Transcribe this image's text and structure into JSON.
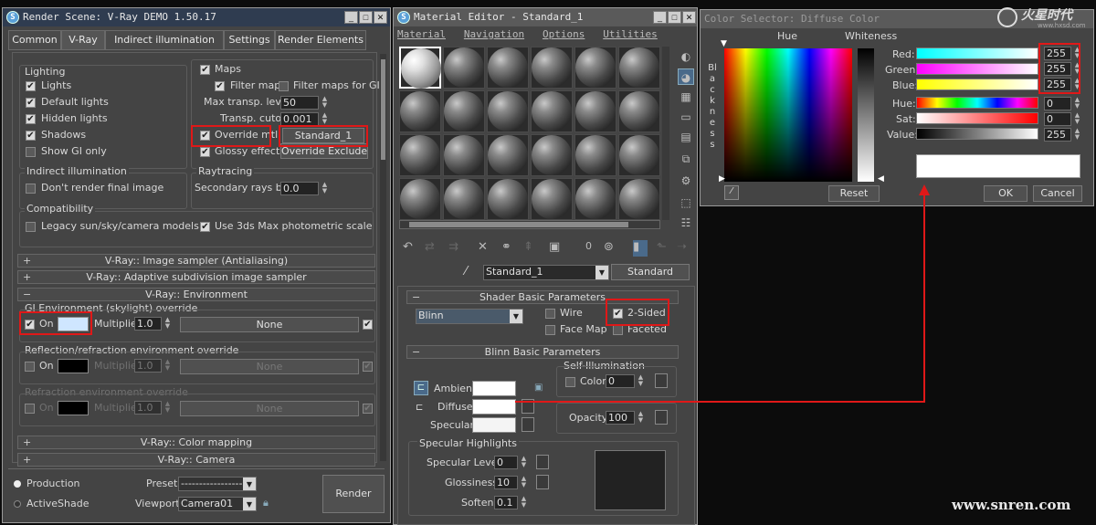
{
  "render": {
    "title": "Render Scene: V-Ray DEMO 1.50.17",
    "tabs": [
      "Common",
      "V-Ray",
      "Indirect illumination",
      "Settings",
      "Render Elements"
    ],
    "lighting": {
      "title": "Lighting",
      "lights": "Lights",
      "default_lights": "Default lights",
      "hidden_lights": "Hidden lights",
      "shadows": "Shadows",
      "show_gi_only": "Show GI only"
    },
    "materials": {
      "maps": "Maps",
      "filter_maps": "Filter maps",
      "filter_maps_gi": "Filter maps for GI",
      "max_transp_levels": "Max transp. levels",
      "max_transp_value": "50",
      "transp_cutoff": "Transp. cutoff",
      "transp_cutoff_value": "0.001",
      "override_mtl": "Override mtl:",
      "override_mtl_value": "Standard_1",
      "glossy_effects": "Glossy effects",
      "override_exclude": "Override Exclude..."
    },
    "indirect": {
      "title": "Indirect illumination",
      "dont_render": "Don't render final image"
    },
    "raytracing": {
      "title": "Raytracing",
      "secondary_bias": "Secondary rays bias",
      "secondary_bias_value": "0.0"
    },
    "compat": {
      "title": "Compatibility",
      "legacy": "Legacy sun/sky/camera models",
      "photometric": "Use 3ds Max photometric scale"
    },
    "rollouts": {
      "image_sampler": "V-Ray:: Image sampler (Antialiasing)",
      "adaptive": "V-Ray:: Adaptive subdivision image sampler",
      "environment": "V-Ray:: Environment",
      "color_mapping": "V-Ray:: Color mapping",
      "camera": "V-Ray:: Camera"
    },
    "env": {
      "gi_title": "GI Environment (skylight) override",
      "on": "On",
      "multiplier": "Multiplier:",
      "mult_value": "1.0",
      "none": "None",
      "refl_title": "Reflection/refraction environment override",
      "refr_title": "Refraction environment override"
    },
    "bottom": {
      "production": "Production",
      "activeshade": "ActiveShade",
      "preset": "Preset:",
      "preset_value": "--------------------",
      "viewport": "Viewport:",
      "viewport_value": "Camera01",
      "render": "Render"
    }
  },
  "material": {
    "title": "Material Editor - Standard_1",
    "menu": [
      "Material",
      "Navigation",
      "Options",
      "Utilities"
    ],
    "mtl_name": "Standard_1",
    "mtl_type": "Standard",
    "shader": {
      "rollout": "Shader Basic Parameters",
      "value": "Blinn",
      "wire": "Wire",
      "two_sided": "2-Sided",
      "face_map": "Face Map",
      "faceted": "Faceted"
    },
    "blinn": {
      "rollout": "Blinn Basic Parameters",
      "self_illum": "Self-Illumination",
      "color": "Color",
      "color_value": "0",
      "ambient": "Ambient:",
      "diffuse": "Diffuse:",
      "specular": "Specular:",
      "opacity": "Opacity:",
      "opacity_value": "100"
    },
    "highlights": {
      "title": "Specular Highlights",
      "spec_level": "Specular Level:",
      "spec_level_value": "0",
      "glossiness": "Glossiness:",
      "glossiness_value": "10",
      "soften": "Soften:",
      "soften_value": "0.1"
    },
    "sample_slot_count": 24
  },
  "color": {
    "title": "Color Selector: Diffuse Color",
    "hue_label": "Hue",
    "whiteness_label": "Whiteness",
    "blackness_label": "Blackness",
    "red": "Red:",
    "green": "Green:",
    "blue": "Blue:",
    "red_value": "255",
    "green_value": "255",
    "blue_value": "255",
    "hue": "Hue:",
    "sat": "Sat:",
    "value": "Value:",
    "hue_value": "0",
    "sat_value": "0",
    "value_value": "255",
    "reset": "Reset",
    "ok": "OK",
    "cancel": "Cancel"
  },
  "watermark": {
    "top_right": "火星时代",
    "top_right_sub": "www.hxsd.com",
    "bottom": "www.snren.com"
  },
  "colors": {
    "highlight": "#e01818",
    "swatch_white": "#ffffff",
    "gi_swatch": "#cfe6ff"
  }
}
